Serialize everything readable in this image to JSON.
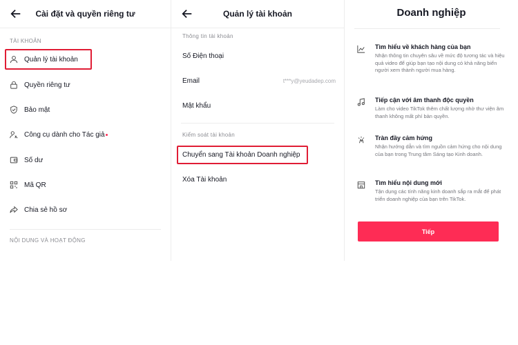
{
  "panel1": {
    "title": "Cài đặt và quyền riêng tư",
    "section_account": "TÀI KHOẢN",
    "items": [
      {
        "label": "Quản lý tài khoản",
        "icon": "user-icon"
      },
      {
        "label": "Quyền riêng tư",
        "icon": "lock-icon"
      },
      {
        "label": "Bảo mật",
        "icon": "shield-icon"
      },
      {
        "label": "Công cụ dành cho Tác giả",
        "icon": "creator-tools-icon"
      },
      {
        "label": "Số dư",
        "icon": "wallet-icon"
      },
      {
        "label": "Mã QR",
        "icon": "qr-code-icon"
      },
      {
        "label": "Chia sẻ hồ sơ",
        "icon": "share-icon"
      }
    ],
    "section_content": "NỘI DUNG VÀ HOẠT ĐỘNG"
  },
  "panel2": {
    "title": "Quản lý tài khoản",
    "section_info": "Thông tin tài khoản",
    "phone_label": "Số Điện thoại",
    "email_label": "Email",
    "email_value": "t***y@yeudadep.com",
    "password_label": "Mật khẩu",
    "section_control": "Kiểm soát tài khoản",
    "switch_label": "Chuyển sang Tài khoản Doanh nghiệp",
    "delete_label": "Xóa Tài khoản"
  },
  "panel3": {
    "title": "Doanh nghiệp",
    "features": [
      {
        "title": "Tìm hiểu về khách hàng của bạn",
        "desc": "Nhận thông tin chuyên sâu về mức độ tương tác và hiệu quả video để giúp bạn tạo nội dung có khả năng biến người xem thành người mua hàng.",
        "icon": "chart-icon"
      },
      {
        "title": "Tiếp cận với âm thanh độc quyền",
        "desc": "Làm cho video TikTok thêm chất lượng nhờ thư viện âm thanh không mất phí bản quyền.",
        "icon": "music-note-icon"
      },
      {
        "title": "Tràn đầy cảm hứng",
        "desc": "Nhận hướng dẫn và tìm nguồn cảm hứng cho nội dung của bạn trong Trung tâm Sáng tạo Kinh doanh.",
        "icon": "inspiration-icon"
      },
      {
        "title": "Tìm hiểu nội dung mới",
        "desc": "Tận dụng các tính năng kinh doanh sắp ra mắt để phát triển doanh nghiệp của bạn trên TikTok.",
        "icon": "store-icon"
      }
    ],
    "cta_label": "Tiếp"
  },
  "colors": {
    "accent": "#fe2c55",
    "highlight": "#e01c34",
    "text": "#161823",
    "muted": "#8a8b91"
  }
}
